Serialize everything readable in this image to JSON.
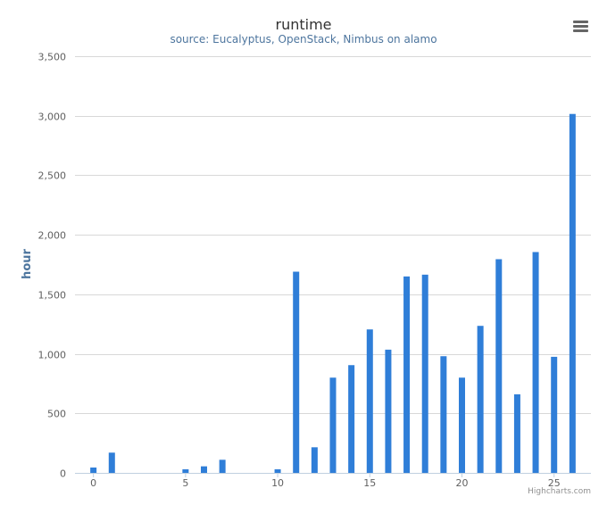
{
  "chart_data": {
    "type": "bar",
    "title": "runtime",
    "subtitle": "source: Eucalyptus, OpenStack, Nimbus on alamo",
    "xlabel": "",
    "ylabel": "hour",
    "x": [
      0,
      1,
      2,
      3,
      4,
      5,
      6,
      7,
      8,
      9,
      10,
      11,
      12,
      13,
      14,
      15,
      16,
      17,
      18,
      19,
      20,
      21,
      22,
      23,
      24,
      25,
      26
    ],
    "values": [
      45,
      170,
      0,
      0,
      0,
      30,
      55,
      110,
      0,
      0,
      30,
      1690,
      215,
      800,
      905,
      1205,
      1035,
      1650,
      1665,
      980,
      800,
      1235,
      1795,
      660,
      1855,
      975,
      3015
    ],
    "xlim": [
      -1,
      27
    ],
    "ylim": [
      0,
      3500
    ],
    "x_ticks": [
      "0",
      "5",
      "10",
      "15",
      "20",
      "25"
    ],
    "x_tick_values": [
      0,
      5,
      10,
      15,
      20,
      25
    ],
    "y_ticks": [
      "0",
      "500",
      "1,000",
      "1,500",
      "2,000",
      "2,500",
      "3,000",
      "3,500"
    ],
    "y_tick_values": [
      0,
      500,
      1000,
      1500,
      2000,
      2500,
      3000,
      3500
    ],
    "grid": true,
    "legend": "none",
    "colors": {
      "bar": "#2f7ed8"
    }
  },
  "credits": "Highcharts.com",
  "menu_icon": "hamburger-menu-icon"
}
